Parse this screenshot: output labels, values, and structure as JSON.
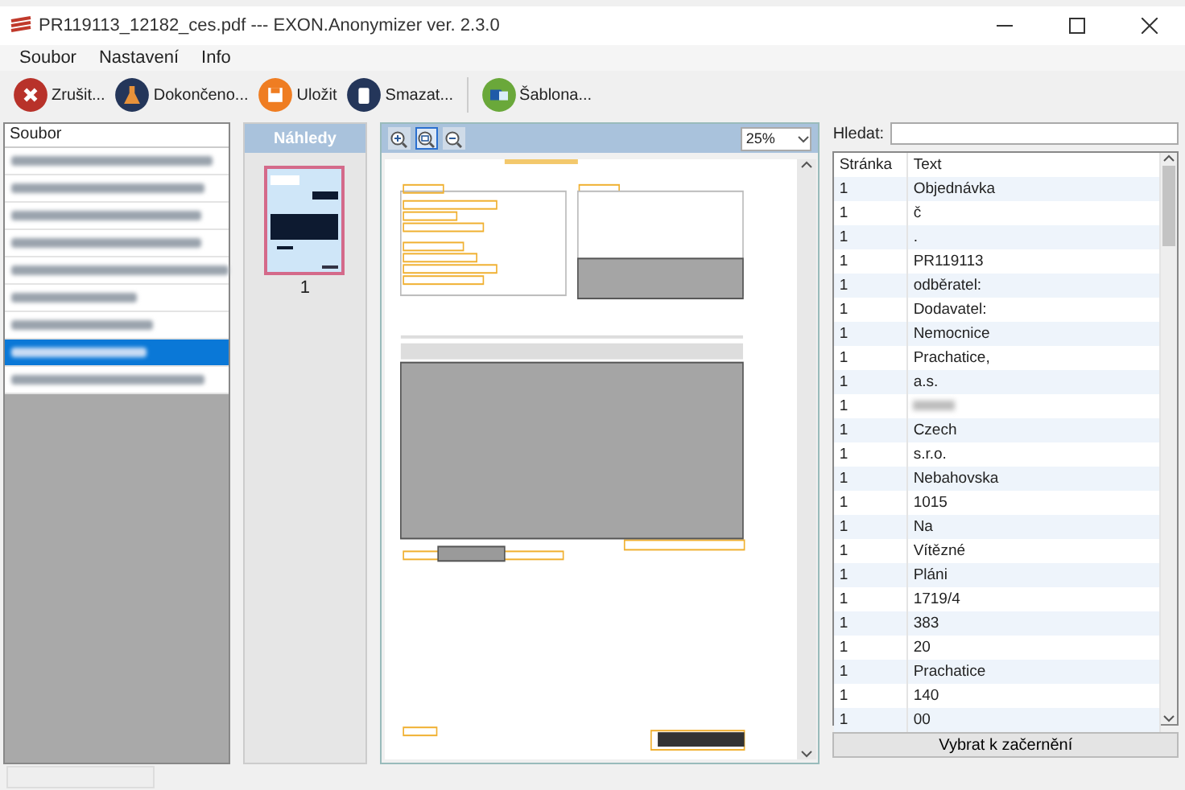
{
  "window": {
    "title": "PR119113_12182_ces.pdf --- EXON.Anonymizer ver. 2.3.0"
  },
  "menu": [
    "Soubor",
    "Nastavení",
    "Info"
  ],
  "toolbar": [
    {
      "label": "Zrušit...",
      "kind": "cancel"
    },
    {
      "label": "Dokončeno...",
      "kind": "finish"
    },
    {
      "label": "Uložit",
      "kind": "save"
    },
    {
      "label": "Smazat...",
      "kind": "delete"
    },
    {
      "label": "Šablona...",
      "kind": "template"
    }
  ],
  "files": {
    "header": "Soubor",
    "items": [
      {
        "selected": false
      },
      {
        "selected": false
      },
      {
        "selected": false
      },
      {
        "selected": false
      },
      {
        "selected": false
      },
      {
        "selected": false
      },
      {
        "selected": false
      },
      {
        "selected": true
      },
      {
        "selected": false
      }
    ]
  },
  "thumbnails": {
    "title": "Náhledy",
    "pages": [
      {
        "label": "1",
        "selected": true
      }
    ]
  },
  "preview": {
    "zoom": "25%",
    "tools": [
      {
        "kind": "zoom-in",
        "selected": false
      },
      {
        "kind": "zoom-fit",
        "selected": true
      },
      {
        "kind": "zoom-out",
        "selected": false
      }
    ]
  },
  "text_panel": {
    "search_label": "Hledat:",
    "columns": [
      "Stránka",
      "Text"
    ],
    "rows": [
      {
        "page": "1",
        "text": "Objednávka",
        "blurred": false
      },
      {
        "page": "1",
        "text": "č",
        "blurred": false
      },
      {
        "page": "1",
        "text": ".",
        "blurred": false
      },
      {
        "page": "1",
        "text": "PR119113",
        "blurred": false
      },
      {
        "page": "1",
        "text": "odběratel:",
        "blurred": false
      },
      {
        "page": "1",
        "text": "Dodavatel:",
        "blurred": false
      },
      {
        "page": "1",
        "text": "Nemocnice",
        "blurred": false
      },
      {
        "page": "1",
        "text": "Prachatice,",
        "blurred": false
      },
      {
        "page": "1",
        "text": "a.s.",
        "blurred": false
      },
      {
        "page": "1",
        "blurred": true
      },
      {
        "page": "1",
        "text": "Czech",
        "blurred": false
      },
      {
        "page": "1",
        "text": "s.r.o.",
        "blurred": false
      },
      {
        "page": "1",
        "text": "Nebahovska",
        "blurred": false
      },
      {
        "page": "1",
        "text": "1015",
        "blurred": false
      },
      {
        "page": "1",
        "text": "Na",
        "blurred": false
      },
      {
        "page": "1",
        "text": "Vítězné",
        "blurred": false
      },
      {
        "page": "1",
        "text": "Pláni",
        "blurred": false
      },
      {
        "page": "1",
        "text": "1719/4",
        "blurred": false
      },
      {
        "page": "1",
        "text": "383",
        "blurred": false
      },
      {
        "page": "1",
        "text": "20",
        "blurred": false
      },
      {
        "page": "1",
        "text": "Prachatice",
        "blurred": false
      },
      {
        "page": "1",
        "text": "140",
        "blurred": false
      },
      {
        "page": "1",
        "text": "00",
        "blurred": false
      }
    ],
    "button": "Vybrat k začernění"
  }
}
